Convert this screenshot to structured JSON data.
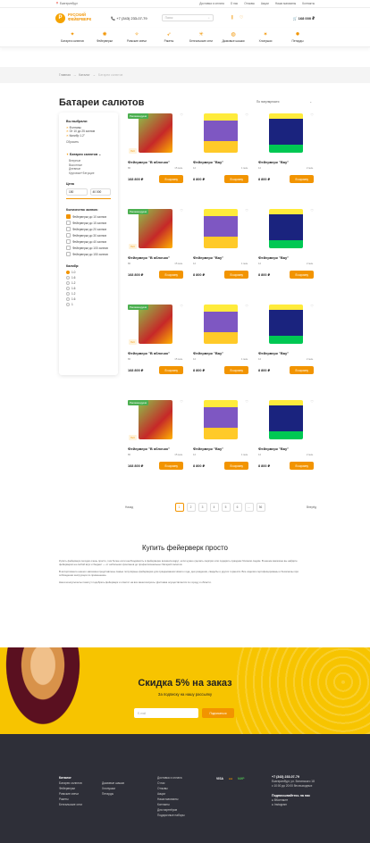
{
  "topbar": {
    "city": "Екатеринбург",
    "links": [
      "Доставка и оплата",
      "О нас",
      "Отзывы",
      "Акции",
      "Наши магазины",
      "Контакты"
    ]
  },
  "header": {
    "logo_line1": "РУССКИЙ",
    "logo_line2": "ФЕЙЕРВЕРК",
    "phone": "+7 (343) 233-07-79",
    "search_placeholder": "Поиск",
    "cart_total": "168 000 ₽"
  },
  "nav": [
    {
      "label": "Батареи салютов",
      "icon": "✦"
    },
    {
      "label": "Фейерверки",
      "icon": "✺"
    },
    {
      "label": "Римские свечи",
      "icon": "✧"
    },
    {
      "label": "Ракеты",
      "icon": "➶"
    },
    {
      "label": "Бенгальские огни",
      "icon": "✳"
    },
    {
      "label": "Дымовые шашки",
      "icon": "◍"
    },
    {
      "label": "Хлопушки",
      "icon": "✶"
    },
    {
      "label": "Петарды",
      "icon": "✹"
    }
  ],
  "breadcrumbs": [
    "Главная",
    "Каталог",
    "Батареи салютов"
  ],
  "page_title": "Батареи салютов",
  "sort": {
    "label": "По популярности"
  },
  "filters": {
    "chosen_title": "Вы выбрали:",
    "chosen": [
      "Фонтаны",
      "От 10 до 25 залпов",
      "Калибр 1.2\""
    ],
    "reset": "Сбросить",
    "category": "Батареи салютов",
    "subcats": [
      "Веерные",
      "Высотные",
      "Дневные",
      "Круговые+Бегущие"
    ],
    "price_title": "Цена",
    "price_from": "150",
    "price_to": "40 000",
    "shots_title": "Количество залпов:",
    "shots": [
      "Фейерверки до 10 залпов",
      "Фейерверки до 15 залпов",
      "Фейерверки до 20 залпов",
      "Фейерверки до 30 залпов",
      "Фейерверки до 40 залпов",
      "Фейерверки до 100 залпов",
      "Фейерверки до 150 залпов"
    ],
    "caliber_title": "Калибр:",
    "calibers": [
      "1.0",
      "1.6",
      "1.2",
      "1.6",
      "1.2",
      "1.6",
      "1"
    ]
  },
  "products": [
    {
      "name": "Фейерверк \"В яблочко\"",
      "badge": "Рекомендуем",
      "tag": "Хит",
      "a": "80",
      "b": "15 мин.",
      "price": "168 800 ₽",
      "buy": "В корзину",
      "kind": "green"
    },
    {
      "name": "Фейерверк \"Вау\"",
      "badge": "",
      "tag": "",
      "a": "12",
      "b": "1 мин.",
      "price": "8 800 ₽",
      "buy": "В корзину",
      "kind": "wow"
    },
    {
      "name": "Фейерверк \"Вау\"",
      "badge": "",
      "tag": "",
      "a": "12",
      "b": "2 мин.",
      "price": "8 800 ₽",
      "buy": "В корзину",
      "kind": "dark"
    },
    {
      "name": "Фейерверк \"В яблочко\"",
      "badge": "Рекомендуем",
      "tag": "Хит",
      "a": "80",
      "b": "15 мин.",
      "price": "168 800 ₽",
      "buy": "В корзину",
      "kind": "green"
    },
    {
      "name": "Фейерверк \"Вау\"",
      "badge": "",
      "tag": "",
      "a": "12",
      "b": "1 мин.",
      "price": "8 800 ₽",
      "buy": "В корзину",
      "kind": "wow"
    },
    {
      "name": "Фейерверк \"Вау\"",
      "badge": "",
      "tag": "",
      "a": "12",
      "b": "2 мин.",
      "price": "8 800 ₽",
      "buy": "В корзину",
      "kind": "dark"
    },
    {
      "name": "Фейерверк \"В яблочко\"",
      "badge": "Рекомендуем",
      "tag": "Хит",
      "a": "80",
      "b": "15 мин.",
      "price": "168 800 ₽",
      "buy": "В корзину",
      "kind": "green"
    },
    {
      "name": "Фейерверк \"Вау\"",
      "badge": "",
      "tag": "",
      "a": "12",
      "b": "1 мин.",
      "price": "8 800 ₽",
      "buy": "В корзину",
      "kind": "wow"
    },
    {
      "name": "Фейерверк \"Вау\"",
      "badge": "",
      "tag": "",
      "a": "12",
      "b": "2 мин.",
      "price": "8 800 ₽",
      "buy": "В корзину",
      "kind": "dark"
    },
    {
      "name": "Фейерверк \"В яблочко\"",
      "badge": "Рекомендуем",
      "tag": "Хит",
      "a": "80",
      "b": "15 мин.",
      "price": "168 800 ₽",
      "buy": "В корзину",
      "kind": "green"
    },
    {
      "name": "Фейерверк \"Вау\"",
      "badge": "",
      "tag": "",
      "a": "12",
      "b": "1 мин.",
      "price": "8 800 ₽",
      "buy": "В корзину",
      "kind": "wow"
    },
    {
      "name": "Фейерверк \"Вау\"",
      "badge": "",
      "tag": "",
      "a": "12",
      "b": "2 мин.",
      "price": "8 800 ₽",
      "buy": "В корзину",
      "kind": "dark"
    }
  ],
  "pager": {
    "prev": "Назад",
    "next": "Вперёд",
    "pages": [
      "1",
      "2",
      "3",
      "4",
      "5",
      "6",
      "...",
      "56"
    ]
  },
  "seo": {
    "title": "Купить фейерверк просто",
    "p": [
      "Купить фейерверк сегодня очень просто, тем более если необходимость в фейерверке возникла вдруг, если нужно сделать сюрприз или подарить праздник близким людям. В нашем магазине вы найдёте фейерверки на любой вкус и бюджет — от небольших фонтанов до профессиональных батарей салютов.",
      "В ассортименте нашего магазина представлены самые популярные фейерверки для празднования Нового года, дня рождения, свадьбы и других торжеств. Все изделия сертифицированы и безопасны при соблюдении инструкции по применению.",
      "Наши консультанты помогут подобрать фейерверк и ответят на все ваши вопросы. Доставка осуществляется по городу и области."
    ]
  },
  "promo": {
    "title": "Скидка 5% на заказ",
    "subtitle": "За подписку на нашу рассылку",
    "email_placeholder": "E-mail",
    "subscribe": "Подписаться"
  },
  "footer": {
    "catalog_title": "Каталог",
    "col1": [
      "Батареи салютов",
      "Фейерверки",
      "Римские свечи",
      "Ракеты",
      "Бенгальские огни"
    ],
    "col2": [
      "Дымовые шашки",
      "Хлопушки",
      "Петарды"
    ],
    "col3": [
      "Доставка и оплата",
      "О нас",
      "Отзывы",
      "Акции",
      "Наши магазины",
      "Контакты",
      "Для партнёров",
      "Подарочные наборы"
    ],
    "payments": [
      "VISA",
      "●●",
      "МИР"
    ],
    "phone": "+7 (343) 233-07-79",
    "address": "Екатеринбург, ул. Белинского 18",
    "hours": "с 10:00 до 20:00 без выходных",
    "social_title": "Подписывайтесь на нас",
    "social": [
      "ВКонтакте",
      "Instagram"
    ]
  }
}
